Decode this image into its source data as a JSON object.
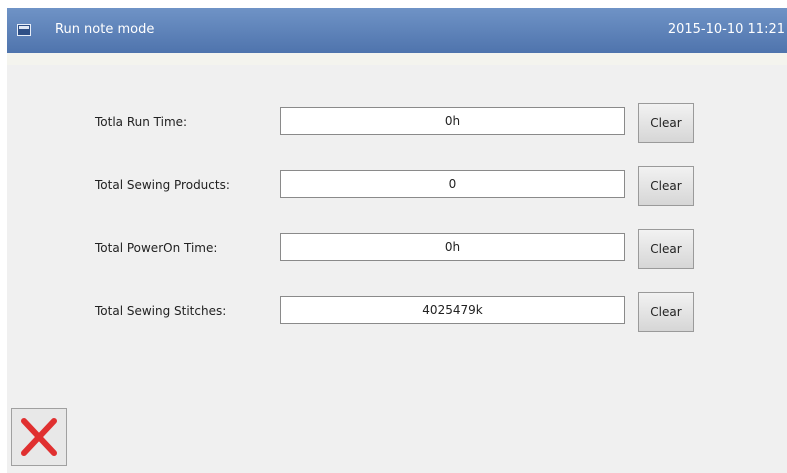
{
  "titlebar": {
    "title": "Run note mode",
    "datetime": "2015-10-10 11:21",
    "icon": "window-icon"
  },
  "rows": [
    {
      "label": "Totla Run Time:",
      "value": "0h",
      "clear_label": "Clear"
    },
    {
      "label": "Total Sewing Products:",
      "value": "0",
      "clear_label": "Clear"
    },
    {
      "label": "Total PowerOn Time:",
      "value": "0h",
      "clear_label": "Clear"
    },
    {
      "label": "Total Sewing Stitches:",
      "value": "4025479k",
      "clear_label": "Clear"
    }
  ],
  "close_button": {
    "icon": "close-x-icon",
    "color": "#e03030"
  },
  "colors": {
    "titlebar": "#5b7fb7",
    "background": "#f0f0f0"
  }
}
